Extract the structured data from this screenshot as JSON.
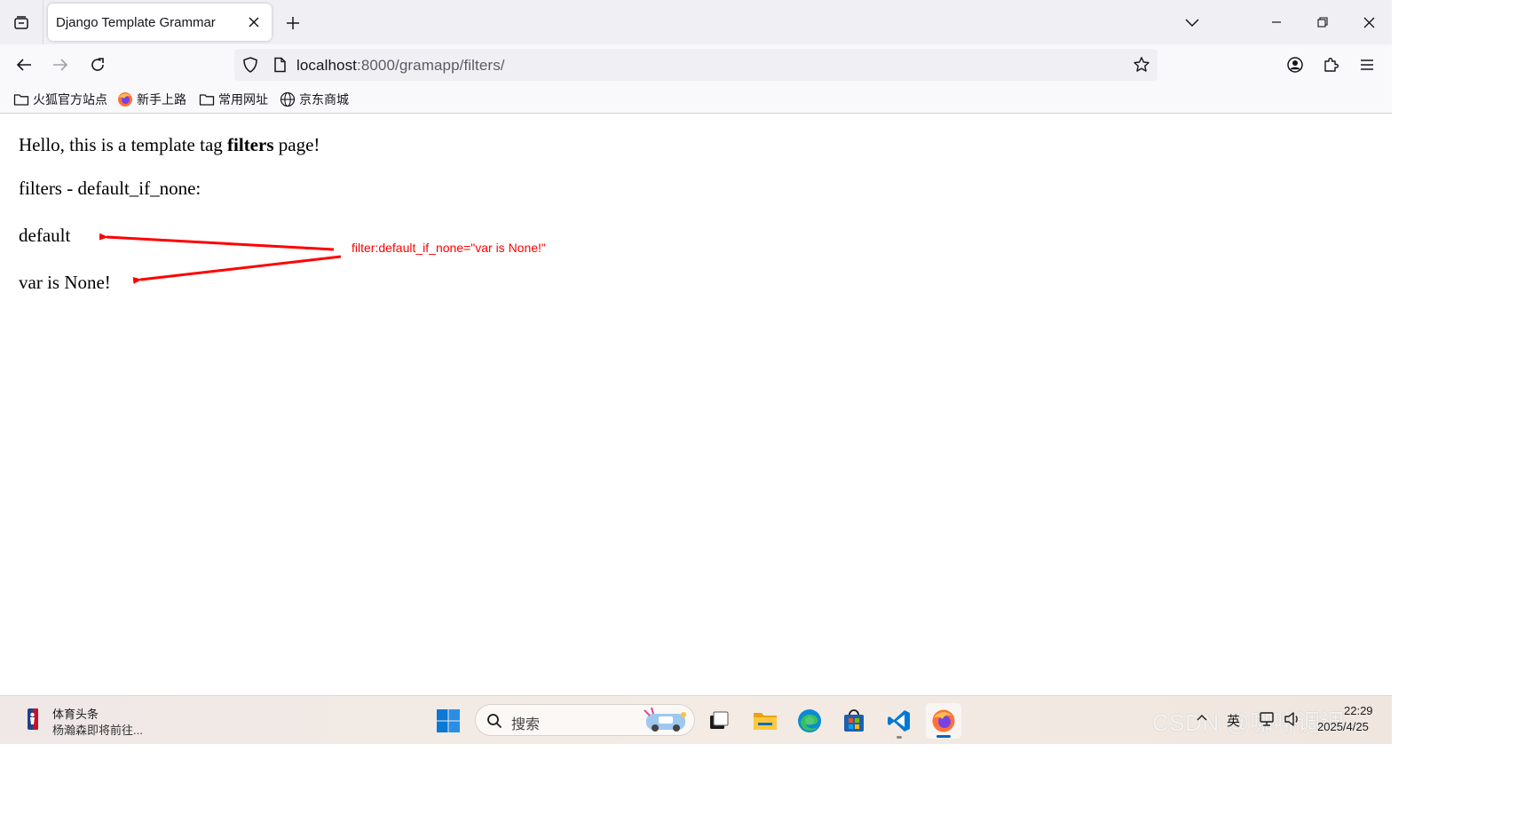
{
  "browser": {
    "tab": {
      "title": "Django Template Grammar"
    },
    "url": {
      "host": "localhost",
      "rest": ":8000/gramapp/filters/"
    },
    "bookmarks": [
      {
        "label": "火狐官方站点",
        "icon": "folder-icon"
      },
      {
        "label": "新手上路",
        "icon": "firefox-icon"
      },
      {
        "label": "常用网址",
        "icon": "folder-icon"
      },
      {
        "label": "京东商城",
        "icon": "globe-icon"
      }
    ]
  },
  "page": {
    "heading_prefix": "Hello, this is a template tag ",
    "heading_bold": "filters",
    "heading_suffix": " page!",
    "filters_line": "filters - default_if_none:",
    "value_1": "default",
    "value_2": "var is None!",
    "annotation": "filter:default_if_none=\"var is None!\"",
    "annotation_color": "#ff0000"
  },
  "taskbar": {
    "news_title": "体育头条",
    "news_subtitle": "杨瀚森即将前往...",
    "search_placeholder": "搜索",
    "tray_ime": "英",
    "clock_time": "22:29",
    "clock_date": "2025/4/25",
    "watermark": "CSDN @咖啡调调"
  }
}
